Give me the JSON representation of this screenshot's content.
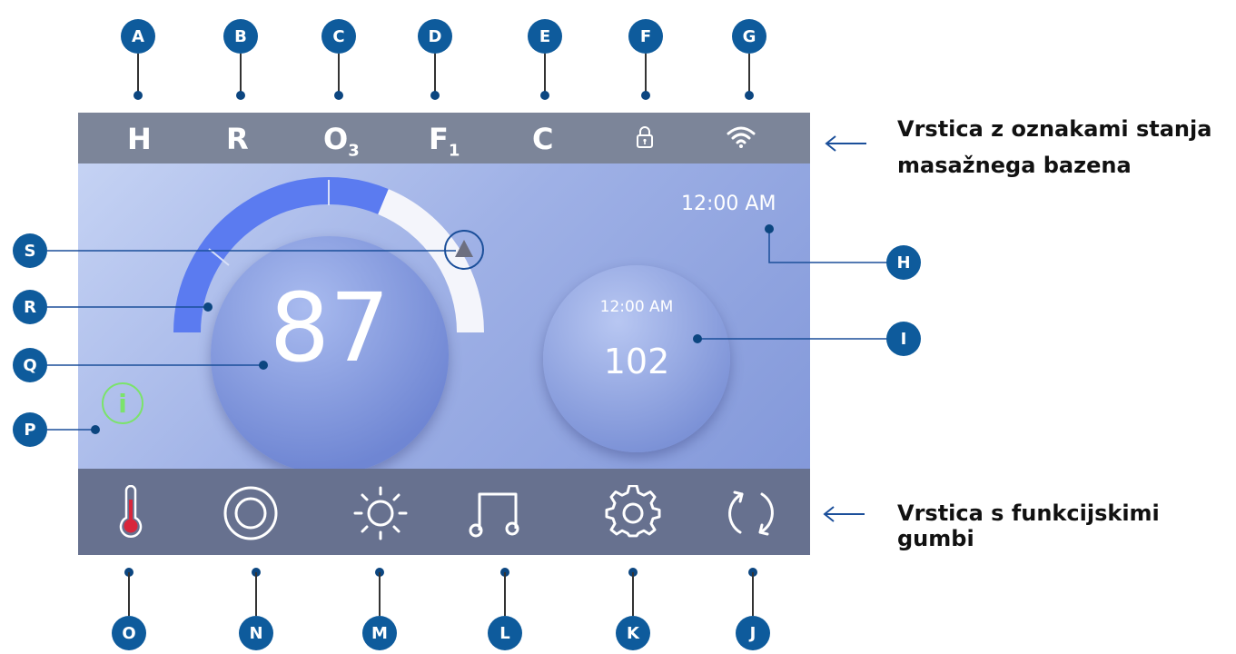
{
  "status_bar": {
    "items": [
      "H",
      "R",
      "O",
      "F",
      "C"
    ],
    "o_sub": "3",
    "f_sub": "1"
  },
  "screen": {
    "temperature": "87",
    "clock": "12:00 AM",
    "set_time": "12:00 AM",
    "set_temperature": "102",
    "info_glyph": "i"
  },
  "labels": {
    "status_bar_caption_line1": "Vrstica z oznakami stanja",
    "status_bar_caption_line2": "masažnega bazena",
    "function_bar_caption": "Vrstica s funkcijskimi gumbi"
  },
  "callouts": {
    "top": [
      "A",
      "B",
      "C",
      "D",
      "E",
      "F",
      "G"
    ],
    "bottom": [
      "O",
      "N",
      "M",
      "L",
      "K",
      "J"
    ],
    "left": [
      "S",
      "R",
      "Q",
      "P"
    ],
    "right": [
      "H",
      "I"
    ]
  },
  "icons": {
    "status": [
      "lock-icon",
      "wifi-icon"
    ],
    "functions": [
      "thermometer-icon",
      "jets-icon",
      "light-icon",
      "music-icon",
      "settings-icon",
      "refresh-icon"
    ]
  },
  "colors": {
    "callout": "#0e5b9c",
    "status_bar": "#7c8599",
    "function_bar": "#67718f",
    "gauge_fill": "#5b7bf0",
    "info_ring": "#7be36b",
    "thermo_red": "#d9263b"
  }
}
